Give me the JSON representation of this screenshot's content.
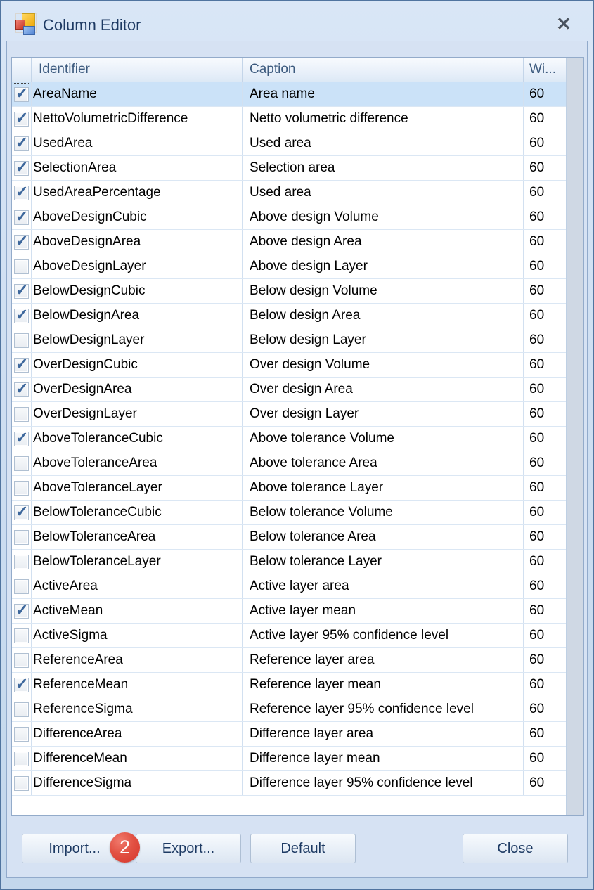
{
  "window": {
    "title": "Column Editor"
  },
  "icons": {
    "close": "✕",
    "check": "✓"
  },
  "table": {
    "headers": {
      "check": "",
      "identifier": "Identifier",
      "caption": "Caption",
      "width": "Wi..."
    },
    "rows": [
      {
        "checked": true,
        "selected": true,
        "identifier": "AreaName",
        "caption": "Area name",
        "width": "60"
      },
      {
        "checked": true,
        "selected": false,
        "identifier": "NettoVolumetricDifference",
        "caption": "Netto volumetric difference",
        "width": "60"
      },
      {
        "checked": true,
        "selected": false,
        "identifier": "UsedArea",
        "caption": "Used area",
        "width": "60"
      },
      {
        "checked": true,
        "selected": false,
        "identifier": "SelectionArea",
        "caption": "Selection area",
        "width": "60"
      },
      {
        "checked": true,
        "selected": false,
        "identifier": "UsedAreaPercentage",
        "caption": "Used area",
        "width": "60"
      },
      {
        "checked": true,
        "selected": false,
        "identifier": "AboveDesignCubic",
        "caption": "Above design Volume",
        "width": "60"
      },
      {
        "checked": true,
        "selected": false,
        "identifier": "AboveDesignArea",
        "caption": "Above design Area",
        "width": "60"
      },
      {
        "checked": false,
        "selected": false,
        "identifier": "AboveDesignLayer",
        "caption": "Above design Layer",
        "width": "60"
      },
      {
        "checked": true,
        "selected": false,
        "identifier": "BelowDesignCubic",
        "caption": "Below design Volume",
        "width": "60"
      },
      {
        "checked": true,
        "selected": false,
        "identifier": "BelowDesignArea",
        "caption": "Below design Area",
        "width": "60"
      },
      {
        "checked": false,
        "selected": false,
        "identifier": "BelowDesignLayer",
        "caption": "Below design Layer",
        "width": "60"
      },
      {
        "checked": true,
        "selected": false,
        "identifier": "OverDesignCubic",
        "caption": "Over design Volume",
        "width": "60"
      },
      {
        "checked": true,
        "selected": false,
        "identifier": "OverDesignArea",
        "caption": "Over design Area",
        "width": "60"
      },
      {
        "checked": false,
        "selected": false,
        "identifier": "OverDesignLayer",
        "caption": "Over design Layer",
        "width": "60"
      },
      {
        "checked": true,
        "selected": false,
        "identifier": "AboveToleranceCubic",
        "caption": "Above tolerance Volume",
        "width": "60"
      },
      {
        "checked": false,
        "selected": false,
        "identifier": "AboveToleranceArea",
        "caption": "Above tolerance Area",
        "width": "60"
      },
      {
        "checked": false,
        "selected": false,
        "identifier": "AboveToleranceLayer",
        "caption": "Above tolerance Layer",
        "width": "60"
      },
      {
        "checked": true,
        "selected": false,
        "identifier": "BelowToleranceCubic",
        "caption": "Below tolerance Volume",
        "width": "60"
      },
      {
        "checked": false,
        "selected": false,
        "identifier": "BelowToleranceArea",
        "caption": "Below tolerance Area",
        "width": "60"
      },
      {
        "checked": false,
        "selected": false,
        "identifier": "BelowToleranceLayer",
        "caption": "Below tolerance Layer",
        "width": "60"
      },
      {
        "checked": false,
        "selected": false,
        "identifier": "ActiveArea",
        "caption": "Active layer area",
        "width": "60"
      },
      {
        "checked": true,
        "selected": false,
        "identifier": "ActiveMean",
        "caption": "Active layer mean",
        "width": "60"
      },
      {
        "checked": false,
        "selected": false,
        "identifier": "ActiveSigma",
        "caption": "Active layer 95% confidence level",
        "width": "60"
      },
      {
        "checked": false,
        "selected": false,
        "identifier": "ReferenceArea",
        "caption": "Reference layer area",
        "width": "60"
      },
      {
        "checked": true,
        "selected": false,
        "identifier": "ReferenceMean",
        "caption": "Reference layer mean",
        "width": "60"
      },
      {
        "checked": false,
        "selected": false,
        "identifier": "ReferenceSigma",
        "caption": "Reference layer 95% confidence level",
        "width": "60"
      },
      {
        "checked": false,
        "selected": false,
        "identifier": "DifferenceArea",
        "caption": "Difference layer area",
        "width": "60"
      },
      {
        "checked": false,
        "selected": false,
        "identifier": "DifferenceMean",
        "caption": "Difference layer mean",
        "width": "60"
      },
      {
        "checked": false,
        "selected": false,
        "identifier": "DifferenceSigma",
        "caption": "Difference layer 95% confidence level",
        "width": "60"
      }
    ]
  },
  "footer": {
    "import_label": "Import...",
    "export_label": "Export...",
    "default_label": "Default",
    "close_label": "Close",
    "badge": {
      "value": "2",
      "color": "#d5342a"
    }
  }
}
